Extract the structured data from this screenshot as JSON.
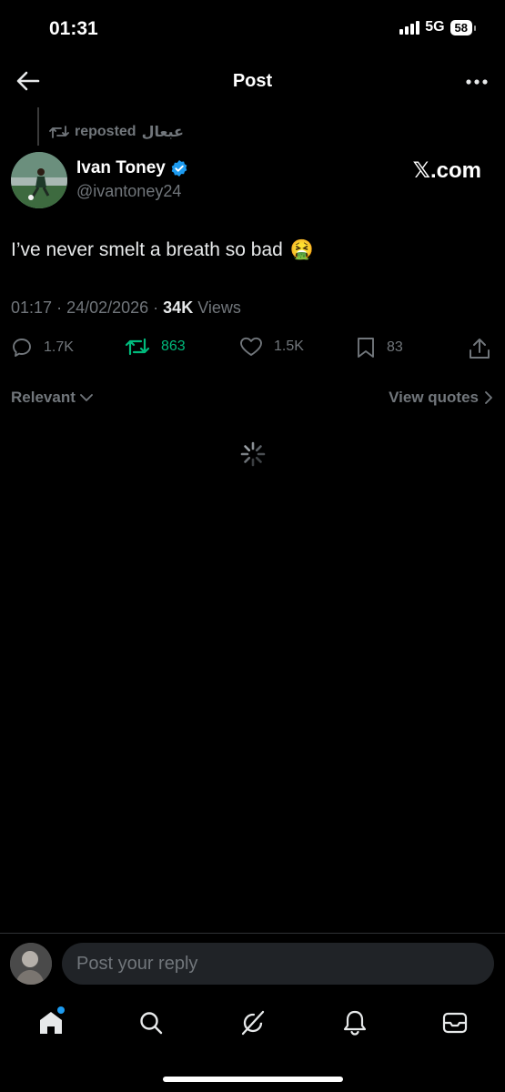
{
  "status": {
    "time": "01:31",
    "network": "5G",
    "battery": "58"
  },
  "header": {
    "title": "Post"
  },
  "repost": {
    "label": "reposted",
    "by": "عبعال"
  },
  "author": {
    "name": "Ivan Toney",
    "handle": "@ivantoney24",
    "source": "𝕏.com"
  },
  "post": {
    "text": "I’ve never smelt a breath so bad",
    "emoji": "🤮",
    "time": "01:17",
    "date": "24/02/2026",
    "views_count": "34K",
    "views_label": "Views"
  },
  "actions": {
    "replies": "1.7K",
    "reposts": "863",
    "likes": "1.5K",
    "bookmarks": "83"
  },
  "sort": {
    "relevant": "Relevant",
    "view_quotes": "View quotes"
  },
  "reply": {
    "placeholder": "Post your reply"
  },
  "colors": {
    "background": "#000000",
    "muted": "#71767b",
    "repost_green": "#00ba7c",
    "verified_blue": "#1d9bf0"
  }
}
